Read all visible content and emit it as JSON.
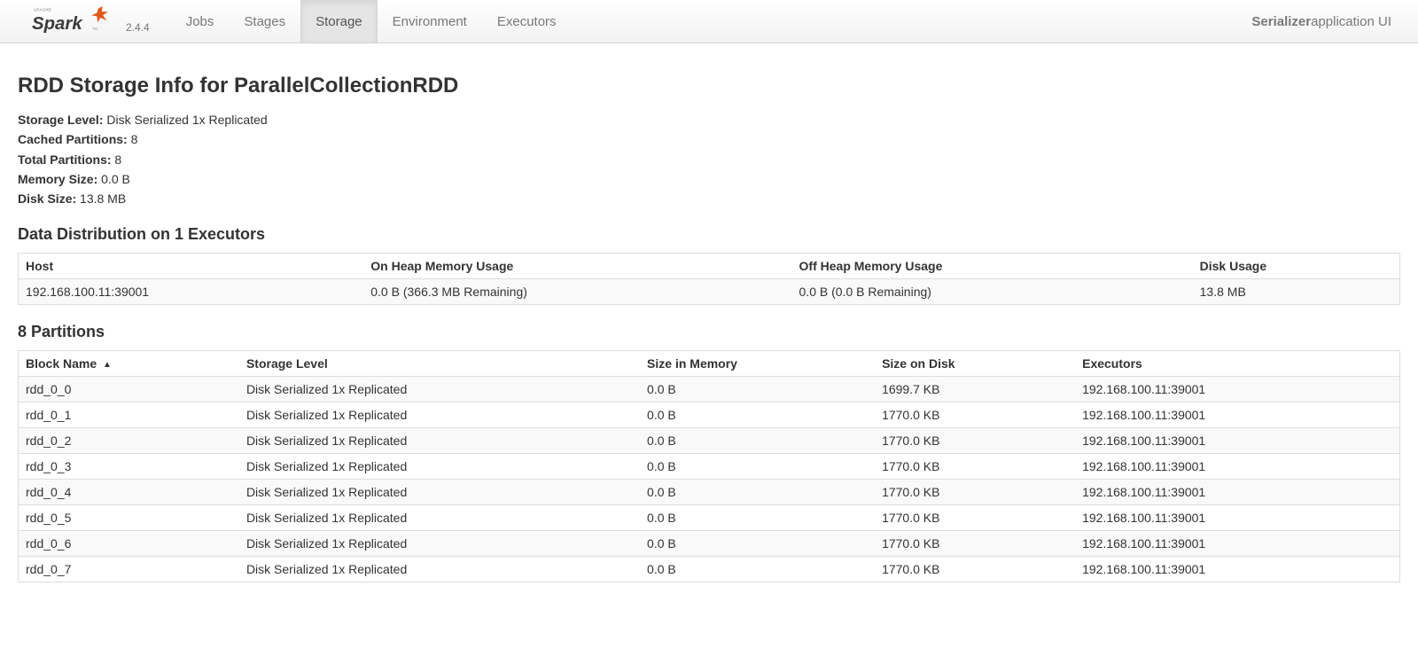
{
  "brand": {
    "version": "2.4.4"
  },
  "navbar": {
    "tabs": [
      {
        "label": "Jobs",
        "active": false
      },
      {
        "label": "Stages",
        "active": false
      },
      {
        "label": "Storage",
        "active": true
      },
      {
        "label": "Environment",
        "active": false
      },
      {
        "label": "Executors",
        "active": false
      }
    ],
    "right_strong": "Serializer",
    "right_rest": " application UI"
  },
  "page_title": "RDD Storage Info for ParallelCollectionRDD",
  "summary": [
    {
      "label": "Storage Level:",
      "value": "Disk Serialized 1x Replicated"
    },
    {
      "label": "Cached Partitions:",
      "value": "8"
    },
    {
      "label": "Total Partitions:",
      "value": "8"
    },
    {
      "label": "Memory Size:",
      "value": "0.0 B"
    },
    {
      "label": "Disk Size:",
      "value": "13.8 MB"
    }
  ],
  "dist_heading": "Data Distribution on 1 Executors",
  "dist_table": {
    "headers": [
      "Host",
      "On Heap Memory Usage",
      "Off Heap Memory Usage",
      "Disk Usage"
    ],
    "rows": [
      [
        "192.168.100.11:39001",
        "0.0 B (366.3 MB Remaining)",
        "0.0 B (0.0 B Remaining)",
        "13.8 MB"
      ]
    ]
  },
  "part_heading": "8 Partitions",
  "part_table": {
    "sort_indicator": "▲",
    "headers": [
      "Block Name",
      "Storage Level",
      "Size in Memory",
      "Size on Disk",
      "Executors"
    ],
    "rows": [
      [
        "rdd_0_0",
        "Disk Serialized 1x Replicated",
        "0.0 B",
        "1699.7 KB",
        "192.168.100.11:39001"
      ],
      [
        "rdd_0_1",
        "Disk Serialized 1x Replicated",
        "0.0 B",
        "1770.0 KB",
        "192.168.100.11:39001"
      ],
      [
        "rdd_0_2",
        "Disk Serialized 1x Replicated",
        "0.0 B",
        "1770.0 KB",
        "192.168.100.11:39001"
      ],
      [
        "rdd_0_3",
        "Disk Serialized 1x Replicated",
        "0.0 B",
        "1770.0 KB",
        "192.168.100.11:39001"
      ],
      [
        "rdd_0_4",
        "Disk Serialized 1x Replicated",
        "0.0 B",
        "1770.0 KB",
        "192.168.100.11:39001"
      ],
      [
        "rdd_0_5",
        "Disk Serialized 1x Replicated",
        "0.0 B",
        "1770.0 KB",
        "192.168.100.11:39001"
      ],
      [
        "rdd_0_6",
        "Disk Serialized 1x Replicated",
        "0.0 B",
        "1770.0 KB",
        "192.168.100.11:39001"
      ],
      [
        "rdd_0_7",
        "Disk Serialized 1x Replicated",
        "0.0 B",
        "1770.0 KB",
        "192.168.100.11:39001"
      ]
    ]
  }
}
